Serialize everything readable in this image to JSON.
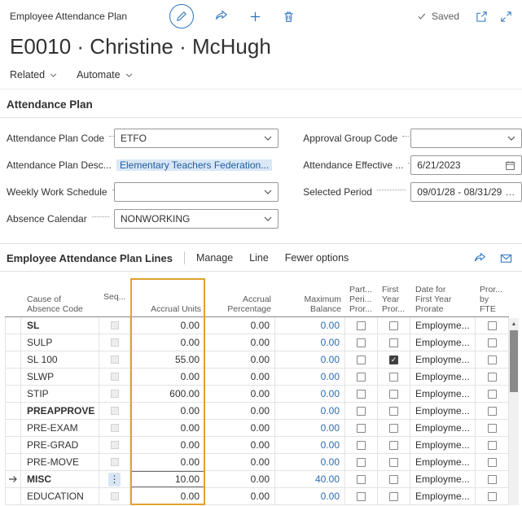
{
  "colors": {
    "accent": "#2b72c0",
    "link": "#2b6cb5",
    "column_highlight": "#dfa22f",
    "selection_bg": "#d9e7f6",
    "selection_text": "#1f5da0"
  },
  "top_bar": {
    "breadcrumb": "Employee Attendance Plan",
    "saved": "Saved",
    "icons": [
      "edit-icon",
      "share-icon",
      "add-icon",
      "delete-icon",
      "check-icon",
      "popout-icon",
      "expand-icon"
    ]
  },
  "page": {
    "title": "E0010 · Christine · McHugh"
  },
  "action_bar": {
    "related": "Related",
    "automate": "Automate"
  },
  "plan_section": {
    "title": "Attendance Plan",
    "fields": {
      "plan_code": {
        "label": "Attendance Plan Code",
        "value": "ETFO"
      },
      "plan_desc": {
        "label": "Attendance Plan Desc...",
        "value": "Elementary Teachers Federation..."
      },
      "weekly_schedule": {
        "label": "Weekly Work Schedule",
        "value": ""
      },
      "absence_calendar": {
        "label": "Absence Calendar",
        "value": "NONWORKING"
      },
      "approval_group": {
        "label": "Approval Group Code",
        "value": ""
      },
      "effective_date": {
        "label": "Attendance Effective ...",
        "value": "6/21/2023"
      },
      "selected_period": {
        "label": "Selected Period",
        "value": "09/01/28 - 08/31/29",
        "ellipsis": "…"
      }
    }
  },
  "lines_section": {
    "title": "Employee Attendance Plan Lines",
    "menu": [
      "Manage",
      "Line",
      "Fewer options"
    ],
    "columns": {
      "code": [
        "Cause of",
        "Absence Code"
      ],
      "seq": [
        "Seq..."
      ],
      "units": [
        "Accrual Units"
      ],
      "pct": [
        "Accrual",
        "Percentage"
      ],
      "max": [
        "Maximum Balance"
      ],
      "part": [
        "Part...",
        "Peri...",
        "Pror..."
      ],
      "first_year": [
        "First",
        "Year",
        "Pror..."
      ],
      "date": [
        "Date for",
        "First Year",
        "Prorate"
      ],
      "fte": [
        "Pror...",
        "by FTE"
      ]
    },
    "rows": [
      {
        "code": "SL",
        "bold": true,
        "units": "0.00",
        "pct": "0.00",
        "max": "0.00",
        "part": false,
        "first_year": false,
        "date": "Employme...",
        "fte": false,
        "current": false,
        "editing": false
      },
      {
        "code": "SULP",
        "bold": false,
        "units": "0.00",
        "pct": "0.00",
        "max": "0.00",
        "part": false,
        "first_year": false,
        "date": "Employme...",
        "fte": false,
        "current": false,
        "editing": false
      },
      {
        "code": "SL 100",
        "bold": false,
        "units": "55.00",
        "pct": "0.00",
        "max": "0.00",
        "part": false,
        "first_year": true,
        "date": "Employme...",
        "fte": false,
        "current": false,
        "editing": false
      },
      {
        "code": "SLWP",
        "bold": false,
        "units": "0.00",
        "pct": "0.00",
        "max": "0.00",
        "part": false,
        "first_year": false,
        "date": "Employme...",
        "fte": false,
        "current": false,
        "editing": false
      },
      {
        "code": "STIP",
        "bold": false,
        "units": "600.00",
        "pct": "0.00",
        "max": "0.00",
        "part": false,
        "first_year": false,
        "date": "Employme...",
        "fte": false,
        "current": false,
        "editing": false
      },
      {
        "code": "PREAPPROVE",
        "bold": true,
        "units": "0.00",
        "pct": "0.00",
        "max": "0.00",
        "part": false,
        "first_year": false,
        "date": "Employme...",
        "fte": false,
        "current": false,
        "editing": false
      },
      {
        "code": "PRE-EXAM",
        "bold": false,
        "units": "0.00",
        "pct": "0.00",
        "max": "0.00",
        "part": false,
        "first_year": false,
        "date": "Employme...",
        "fte": false,
        "current": false,
        "editing": false
      },
      {
        "code": "PRE-GRAD",
        "bold": false,
        "units": "0.00",
        "pct": "0.00",
        "max": "0.00",
        "part": false,
        "first_year": false,
        "date": "Employme...",
        "fte": false,
        "current": false,
        "editing": false
      },
      {
        "code": "PRE-MOVE",
        "bold": false,
        "units": "0.00",
        "pct": "0.00",
        "max": "0.00",
        "part": false,
        "first_year": false,
        "date": "Employme...",
        "fte": false,
        "current": false,
        "editing": false
      },
      {
        "code": "MISC",
        "bold": true,
        "units": "10.00",
        "pct": "0.00",
        "max": "40.00",
        "part": false,
        "first_year": false,
        "date": "Employme...",
        "fte": false,
        "current": true,
        "editing": true
      },
      {
        "code": "EDUCATION",
        "bold": false,
        "units": "0.00",
        "pct": "0.00",
        "max": "0.00",
        "part": false,
        "first_year": false,
        "date": "Employme...",
        "fte": false,
        "current": false,
        "editing": false
      }
    ]
  }
}
